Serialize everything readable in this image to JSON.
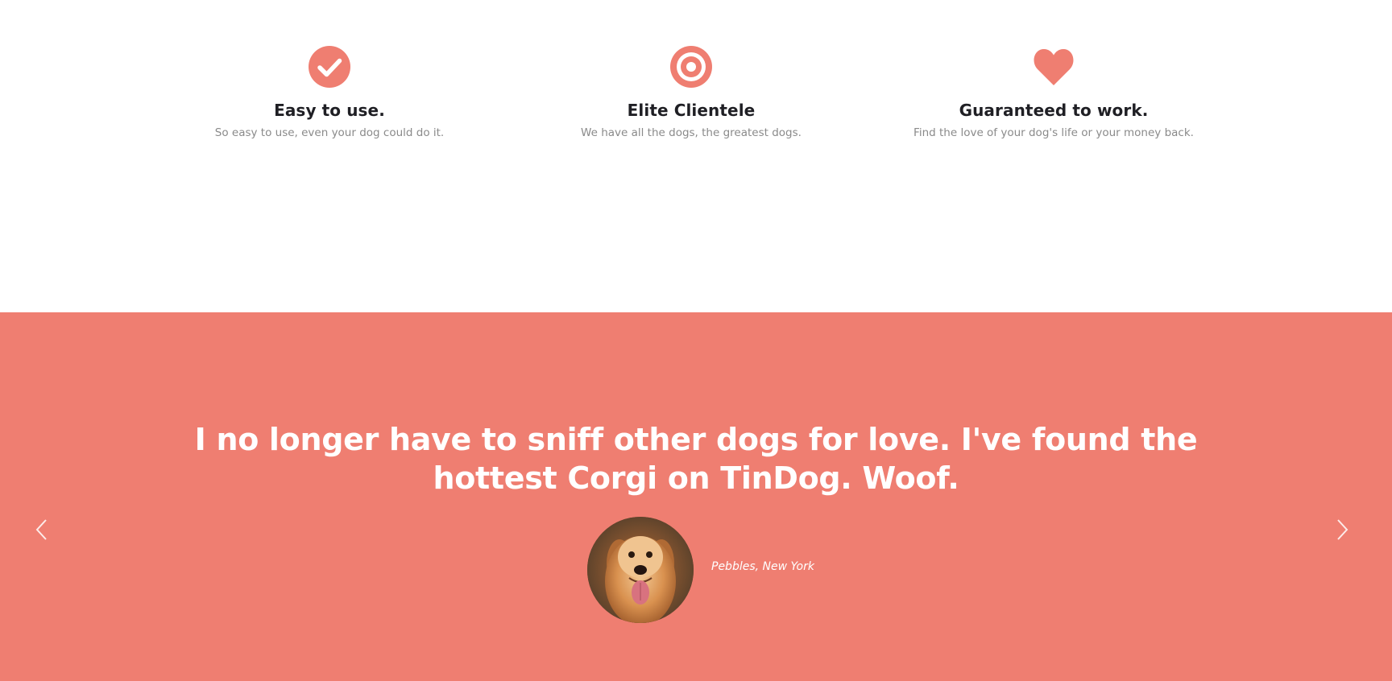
{
  "features": [
    {
      "icon": "check-circle-icon",
      "title": "Easy to use.",
      "text": "So easy to use, even your dog could do it."
    },
    {
      "icon": "bullseye-icon",
      "title": "Elite Clientele",
      "text": "We have all the dogs, the greatest dogs."
    },
    {
      "icon": "heart-icon",
      "title": "Guaranteed to work.",
      "text": "Find the love of your dog's life or your money back."
    }
  ],
  "testimonial": {
    "quote": "I no longer have to sniff other dogs for love. I've found the hottest Corgi on TinDog. Woof.",
    "author": "Pebbles, New York",
    "avatar": "golden-retriever-photo"
  },
  "colors": {
    "accent": "#ef7e71",
    "heading": "#1f1f24",
    "muted": "#8a8a8a",
    "white": "#ffffff"
  }
}
